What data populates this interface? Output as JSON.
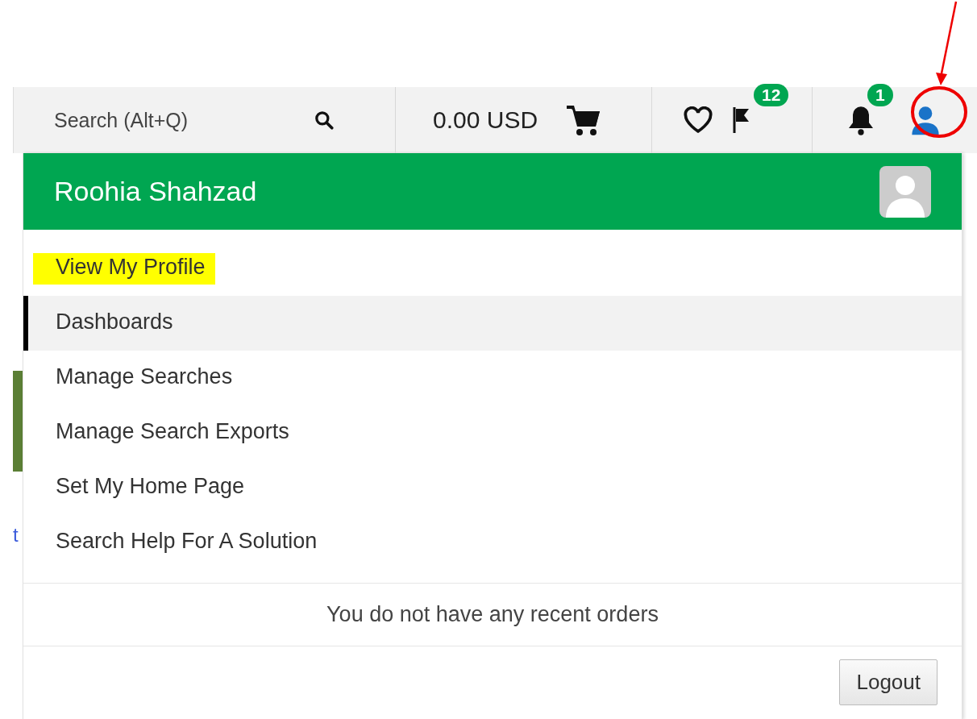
{
  "topbar": {
    "search": {
      "placeholder": "Search (Alt+Q)"
    },
    "cart": {
      "amount": "0.00 USD"
    },
    "badges": {
      "flags": "12",
      "notifications": "1"
    }
  },
  "background": {
    "fragment": "t"
  },
  "menu": {
    "user_name": "Roohia Shahzad",
    "items": [
      {
        "label": "View My Profile",
        "selected": false,
        "highlighted": true
      },
      {
        "label": "Dashboards",
        "selected": true,
        "highlighted": false
      },
      {
        "label": "Manage Searches",
        "selected": false,
        "highlighted": false
      },
      {
        "label": "Manage Search Exports",
        "selected": false,
        "highlighted": false
      },
      {
        "label": "Set My Home Page",
        "selected": false,
        "highlighted": false
      },
      {
        "label": "Search Help For A Solution",
        "selected": false,
        "highlighted": false
      }
    ],
    "recent_orders": "You do not have any recent orders",
    "logout": "Logout"
  }
}
